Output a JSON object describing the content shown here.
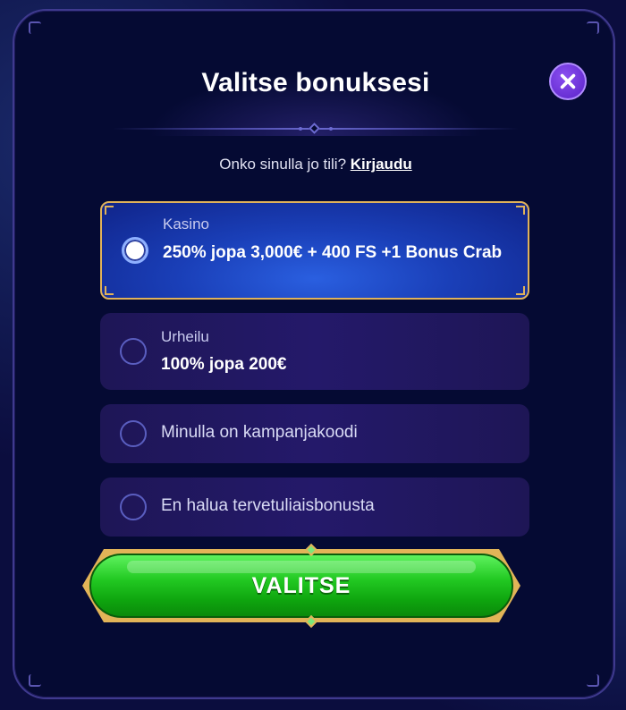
{
  "modal": {
    "title": "Valitse bonuksesi",
    "login_prompt": "Onko sinulla jo tili?",
    "login_link": "Kirjaudu",
    "close_label": "×"
  },
  "options": [
    {
      "category": "Kasino",
      "text": "250% jopa 3,000€ + 400 FS +1 Bonus Crab",
      "selected": true
    },
    {
      "category": "Urheilu",
      "text": "100% jopa 200€",
      "selected": false
    },
    {
      "text": "Minulla on kampanjakoodi",
      "selected": false
    },
    {
      "text": "En halua tervetuliaisbonusta",
      "selected": false
    }
  ],
  "cta": {
    "label": "VALITSE"
  },
  "colors": {
    "accent_gold": "#e0b25a",
    "cta_green": "#22c922",
    "selected_blue": "#1a3fb8",
    "close_purple": "#6a2fd8"
  }
}
